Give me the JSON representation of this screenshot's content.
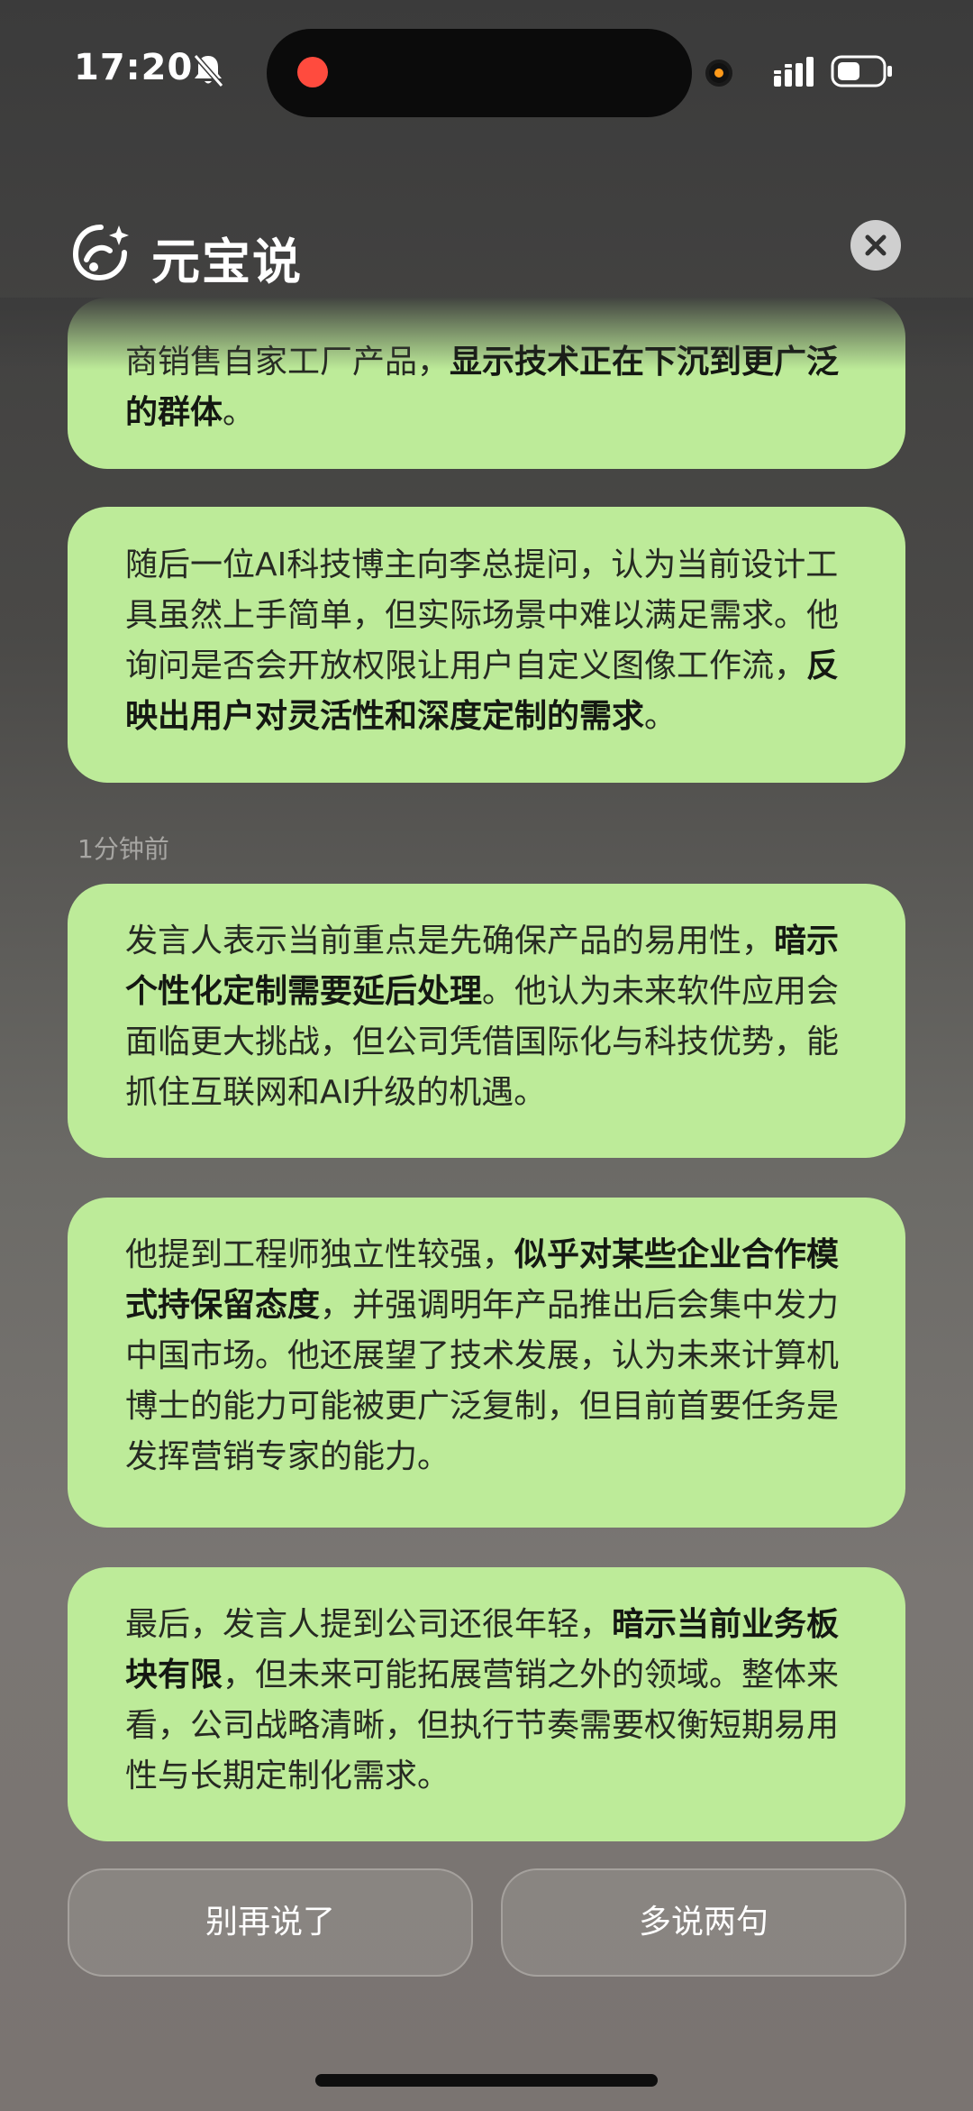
{
  "status_bar": {
    "time": "17:20",
    "icons": [
      "bell-slash-icon",
      "recording-dot-icon",
      "camera-indicator-icon",
      "signal-icon",
      "battery-icon"
    ]
  },
  "header": {
    "title": "元宝说",
    "logo_icon": "yuanbao-logo-icon",
    "close_icon": "close-icon"
  },
  "cards": [
    {
      "segments": [
        {
          "text": "商销售自家工厂产品，",
          "bold": false
        },
        {
          "text": "显示技术正在下沉到更广泛的群体",
          "bold": true
        },
        {
          "text": "。",
          "bold": false
        }
      ]
    },
    {
      "segments": [
        {
          "text": "随后一位AI科技博主向李总提问，认为当前设计工具虽然上手简单，但实际场景中难以满足需求。他询问是否会开放权限让用户自定义图像工作流，",
          "bold": false
        },
        {
          "text": "反映出用户对灵活性和深度定制的需求",
          "bold": true
        },
        {
          "text": "。",
          "bold": false
        }
      ]
    },
    {
      "segments": [
        {
          "text": "发言人表示当前重点是先确保产品的易用性，",
          "bold": false
        },
        {
          "text": "暗示个性化定制需要延后处理",
          "bold": true
        },
        {
          "text": "。他认为未来软件应用会面临更大挑战，但公司凭借国际化与科技优势，能抓住互联网和AI升级的机遇。",
          "bold": false
        }
      ]
    },
    {
      "segments": [
        {
          "text": "他提到工程师独立性较强，",
          "bold": false
        },
        {
          "text": "似乎对某些企业合作模式持保留态度",
          "bold": true
        },
        {
          "text": "，并强调明年产品推出后会集中发力中国市场。他还展望了技术发展，认为未来计算机博士的能力可能被更广泛复制，但目前首要任务是发挥营销专家的能力。",
          "bold": false
        }
      ]
    },
    {
      "segments": [
        {
          "text": "最后，发言人提到公司还很年轻，",
          "bold": false
        },
        {
          "text": "暗示当前业务板块有限",
          "bold": true
        },
        {
          "text": "，但未来可能拓展营销之外的领域。整体来看，公司战略清晰，但执行节奏需要权衡短期易用性与长期定制化需求。",
          "bold": false
        }
      ]
    }
  ],
  "timestamp": "1分钟前",
  "buttons": {
    "stop_label": "别再说了",
    "more_label": "多说两句"
  },
  "colors": {
    "card_bg": "#bdeb99",
    "recording": "#ff4b3e",
    "camera_indicator": "#ff9a1a"
  }
}
